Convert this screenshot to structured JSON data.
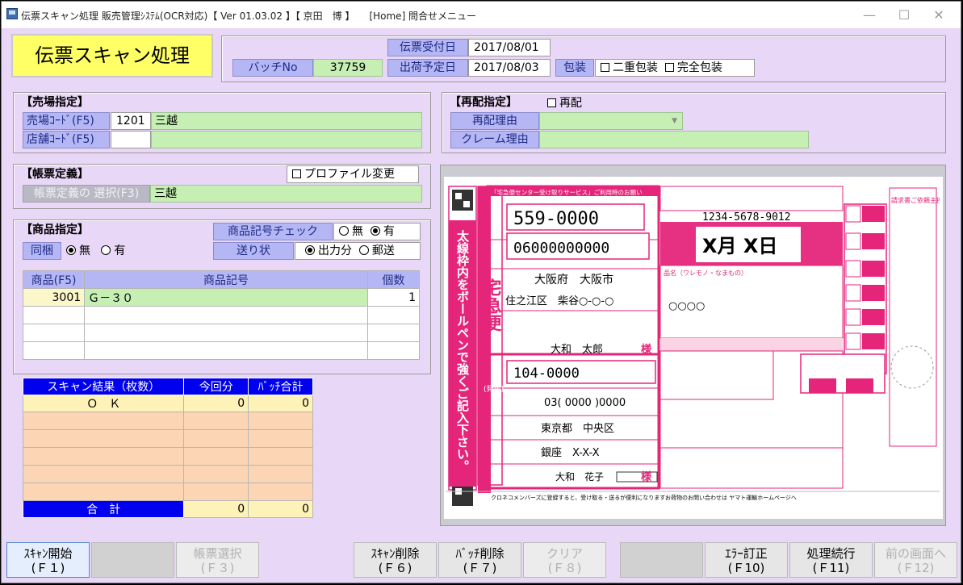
{
  "titlebar": {
    "title": "伝票スキャン処理 販売管理ｼｽﾃﾑ(OCR対応)【 Ver 01.03.02 】【 京田　博 】　　[Home] 問合せメニュー",
    "minimize": "—",
    "maximize": "☐",
    "close": "✕"
  },
  "header": {
    "screen_title": "伝票スキャン処理",
    "batch_label": "バッチNo",
    "batch_no": "37759",
    "receipt_date_label": "伝票受付日",
    "receipt_date": "2017/08/01",
    "ship_date_label": "出荷予定日",
    "ship_date": "2017/08/03",
    "packing_label": "包装",
    "double_pack": "二重包装",
    "full_pack": "完全包装"
  },
  "store": {
    "section": "【売場指定】",
    "store_code_label": "売場ｺｰﾄﾞ(F5)",
    "store_code": "1201",
    "store_name": "三越",
    "shop_code_label": "店舗ｺｰﾄﾞ(F5)",
    "shop_code": "",
    "shop_name": ""
  },
  "redelivery": {
    "section": "【再配指定】",
    "redeliver_check": "再配",
    "reason_label": "再配理由",
    "reason_value": "",
    "claim_label": "クレーム理由",
    "claim_value": ""
  },
  "form_def": {
    "section": "【帳票定義】",
    "profile_change": "プロファイル変更",
    "select_label": "帳票定義の 選択(F3)",
    "select_value": "三越"
  },
  "product": {
    "section": "【商品指定】",
    "code_check_label": "商品記号チェック",
    "code_check_none": "無",
    "code_check_yes": "有",
    "bundle_label": "同梱",
    "bundle_none": "無",
    "bundle_yes": "有",
    "invoice_label": "送り状",
    "invoice_output": "出力分",
    "invoice_mail": "郵送",
    "columns": [
      "商品(F5)",
      "商品記号",
      "個数"
    ],
    "rows": [
      {
        "code": "3001",
        "symbol": "Ｇ－３０",
        "qty": "1"
      }
    ]
  },
  "scan_results": {
    "columns": [
      "スキャン結果（枚数）",
      "今回分",
      "ﾊﾞｯﾁ合計"
    ],
    "rows": [
      {
        "result": "Ｏ　Ｋ",
        "current": "0",
        "batch_total": "0"
      }
    ],
    "total_label": "合　計",
    "total_current": "0",
    "total_batch": "0"
  },
  "slip": {
    "header_text": "「宅急便センター受け取りサービス」ご利用時のお願い",
    "zip_to": "559-0000",
    "tel_to": "06000000000",
    "addr_to_1": "大阪府　大阪市",
    "addr_to_2": "住之江区　柴谷○-○-○",
    "name_to": "大和　太郎",
    "honorific": "様",
    "zip_from": "104-0000",
    "tel_from": "03( 0000 )0000",
    "addr_from_1": "東京都　中央区",
    "addr_from_2": "銀座　X-X-X",
    "name_from": "大和　花子",
    "tracking": "1234-5678-9012",
    "delivery_date": "X月 X日",
    "item_text": "○○○○",
    "side_text": "太線枠内をボールペンで強くご記入下さい。",
    "brand": "宅急便",
    "brand_sub": "(発払)",
    "pay_note": "請求書ご依頼主控",
    "members_note": "クロネコメンバーズに登録すると、受け取る・送るが便利になります",
    "hp_note": "お荷物のお問い合わせは ヤマト運輸ホームページへ",
    "note_line": "品名（ワレモノ・なまもの）",
    "accent": "#e5257a"
  },
  "fkeys": [
    {
      "label": "ｽｷｬﾝ開始",
      "key": "(Ｆ１)"
    },
    {
      "label": "",
      "key": ""
    },
    {
      "label": "帳票選択",
      "key": "(Ｆ３)"
    },
    {
      "label": "ｽｷｬﾝ削除",
      "key": "(Ｆ６)"
    },
    {
      "label": "ﾊﾞｯﾁ削除",
      "key": "(Ｆ７)"
    },
    {
      "label": "クリア",
      "key": "(Ｆ８)"
    },
    {
      "label": "",
      "key": ""
    },
    {
      "label": "ｴﾗｰ訂正",
      "key": "(Ｆ10)"
    },
    {
      "label": "処理続行",
      "key": "(Ｆ11)"
    },
    {
      "label": "前の画面へ",
      "key": "(Ｆ12)"
    }
  ]
}
